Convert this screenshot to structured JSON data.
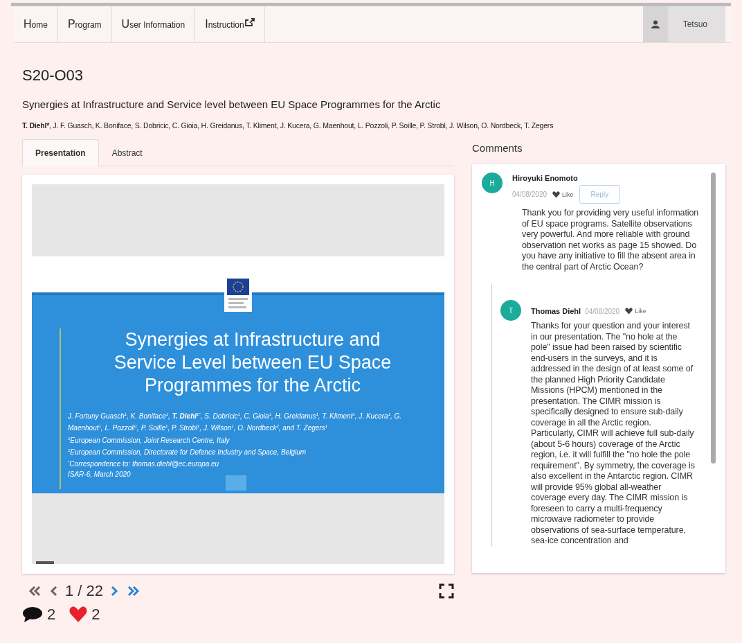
{
  "nav": {
    "items": [
      {
        "label": "Home",
        "external": false
      },
      {
        "label": "Program",
        "external": false
      },
      {
        "label": "User Information",
        "external": false
      },
      {
        "label": "Instruction",
        "external": true
      }
    ],
    "user": "Tetsuo"
  },
  "paper": {
    "code": "S20-O03",
    "title": "Synergies at Infrastructure and Service level between EU Space Programmes for the Arctic",
    "lead_author": "T. Diehl*",
    "other_authors": ", J. F. Guasch, K. Boniface, S. Dobricic, C. Gioia, H. Greidanus, T. Kliment, J. Kucera, G. Maenhout, L. Pozzoli, P. Soille, P. Strobl, J. Wilson, O. Nordbeck, T. Zegers"
  },
  "tabs": [
    {
      "label": "Presentation",
      "selected": true
    },
    {
      "label": "Abstract",
      "selected": false
    }
  ],
  "slide": {
    "title": "Synergies at Infrastructure and Service Level between EU Space Programmes for the Arctic",
    "authors": "J. Fortuny Guasch$^{1}$, K. Boniface$^{1}$, **T. Diehl**$^{1*}$, S. Dobricic$^{1}$, C. Gioia$^{1}$, H. Greidanus$^{1}$, T. Kliment$^{1}$, J. Kucera$^{1}$, G. Maenhout$^{1}$, L. Pozzoli$^{1}$, P. Soille$^{1}$, P. Strobl$^{1}$, J. Wilson$^{1}$, O. Nordbeck$^{2}$, and T. Zegers$^{1}$",
    "affiliations": [
      {
        "mark": "1",
        "text": "European Commission, Joint Research Centre, Italy"
      },
      {
        "mark": "2",
        "text": "European Commission, Directorate for Defence Industry and Space, Belgium"
      },
      {
        "mark": "*",
        "text": "Correspondence to: thomas.diehl@ec.europa.eu"
      }
    ],
    "event": "ISAR-6, March 2020"
  },
  "pager": {
    "position": "1 / 22"
  },
  "stats": {
    "comments": "2",
    "likes": "2"
  },
  "comments": {
    "heading": "Comments",
    "items": [
      {
        "initial": "H",
        "author": "Hiroyuki Enomoto",
        "date": "04/08/2020",
        "like": "Like",
        "reply_button": "Reply",
        "text": "Thank you for providing very useful information of EU space programs. Satellite observations very powerful. And more reliable with ground observation net works as page 15 showed. Do you have any initiative to fill the absent area in the central part of Arctic Ocean?",
        "children": [
          {
            "initial": "T",
            "author": "Thomas Diehl",
            "date": "04/08/2020",
            "like": "Like",
            "text": "Thanks for your question and your interest in our presentation. The \"no hole at the pole\" issue had been raised by scientific end-users in the surveys, and it is addressed in the design of at least some of the planned High Priority Candidate Missions (HPCM) mentioned in the presentation. The CIMR mission is specifically designed to ensure sub-daily coverage in all the Arctic region. Particularly, CIMR will achieve full sub-daily (about 5-6 hours) coverage of the Arctic region, i.e. it will fulfill the \"no hole the pole requirement\". By symmetry, the coverage is also excellent in the Antarctic region. CIMR will provide 95% global all-weather coverage every day. The CIMR mission is foreseen to carry a multi-frequency microwave radiometer to provide observations of sea-surface temperature, sea-ice concentration and"
          }
        ]
      }
    ]
  }
}
